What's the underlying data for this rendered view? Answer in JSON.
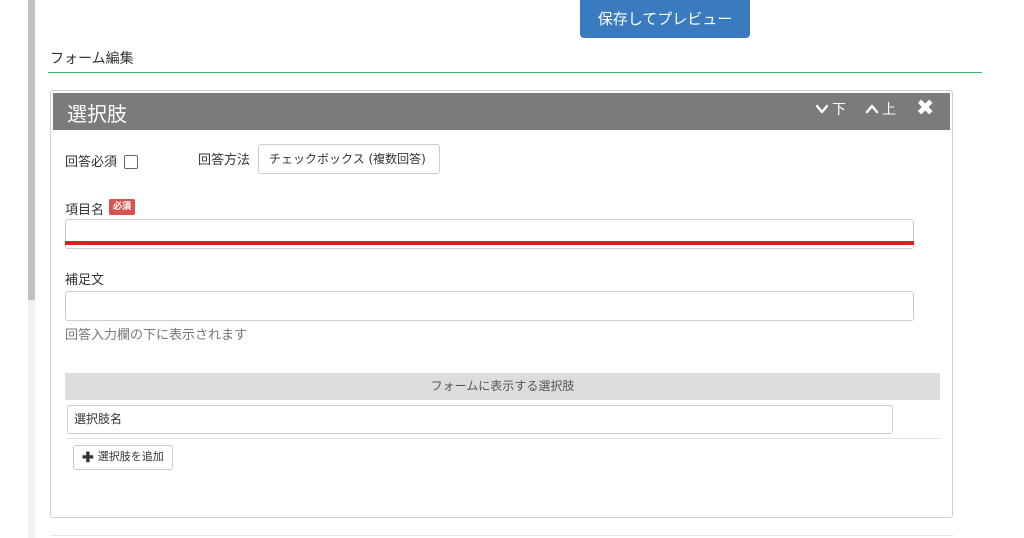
{
  "toolbar": {
    "save_preview_label": "保存してプレビュー"
  },
  "form_edit": {
    "title": "フォーム編集"
  },
  "panel": {
    "title": "選択肢",
    "move_down_label": "下",
    "move_up_label": "上",
    "close_glyph": "✖"
  },
  "fields": {
    "required_label": "回答必須",
    "answer_method_label": "回答方法",
    "answer_method_value": "チェックボックス (複数回答)",
    "item_name_label": "項目名",
    "required_badge": "必須",
    "item_name_value": "",
    "supplement_label": "補足文",
    "supplement_value": "",
    "supplement_help": "回答入力欄の下に表示されます"
  },
  "choices": {
    "header": "フォームに表示する選択肢",
    "items": [
      "選択肢名"
    ],
    "add_button_label": "選択肢を追加"
  },
  "colors": {
    "accent_button": "#3a7bbf",
    "header_bar": "#7b7b7b",
    "rule_green": "#2eb872",
    "required_badge": "#d9534f",
    "error_underline": "#e02020"
  },
  "icons": {
    "move_down": "chevron-down-icon",
    "move_up": "chevron-up-icon",
    "close": "close-icon",
    "add": "plus-icon"
  }
}
